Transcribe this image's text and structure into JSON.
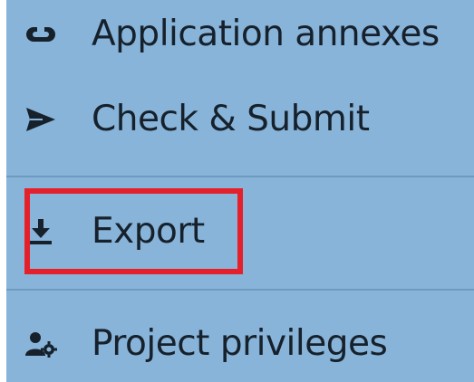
{
  "menu": {
    "items": [
      {
        "label": "Application annexes",
        "icon": "link-icon"
      },
      {
        "label": "Check & Submit",
        "icon": "send-icon"
      },
      {
        "label": "Export",
        "icon": "download-icon"
      },
      {
        "label": "Project privileges",
        "icon": "user-settings-icon"
      }
    ]
  },
  "colors": {
    "panel_background": "#88b4d9",
    "text": "#16212c",
    "divider": "#6f9ac0",
    "highlight_border": "#e5202a"
  }
}
